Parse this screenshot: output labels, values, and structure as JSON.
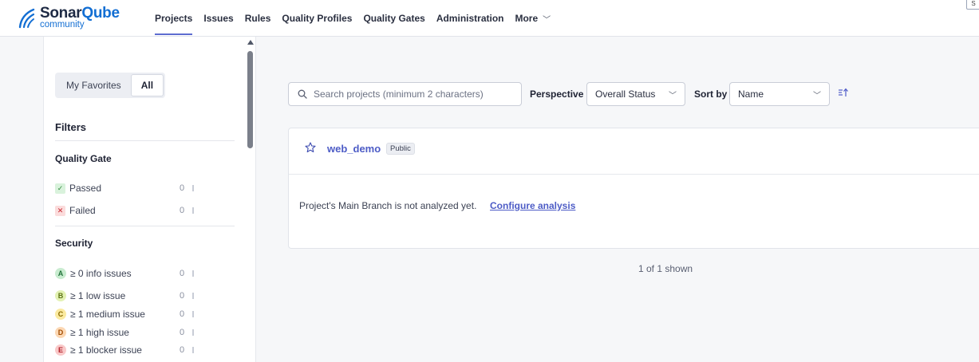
{
  "brand": {
    "name_part1": "Sonar",
    "name_part2": "Qube",
    "edition": "community",
    "accent_color": "#126ed3"
  },
  "nav": {
    "items": [
      {
        "label": "Projects",
        "active": true
      },
      {
        "label": "Issues"
      },
      {
        "label": "Rules"
      },
      {
        "label": "Quality Profiles"
      },
      {
        "label": "Quality Gates"
      },
      {
        "label": "Administration"
      },
      {
        "label": "More"
      }
    ],
    "corner_chip": "S"
  },
  "sidebar": {
    "toggle": {
      "favorites": "My Favorites",
      "all": "All",
      "selected": "All"
    },
    "filters_title": "Filters",
    "quality_gate": {
      "title": "Quality Gate",
      "items": [
        {
          "label": "Passed",
          "count": "0",
          "badge": "✓"
        },
        {
          "label": "Failed",
          "count": "0",
          "badge": "✕"
        }
      ]
    },
    "security": {
      "title": "Security",
      "items": [
        {
          "grade": "A",
          "label": "≥ 0 info issues",
          "count": "0"
        },
        {
          "grade": "B",
          "label": "≥ 1 low issue",
          "count": "0"
        },
        {
          "grade": "C",
          "label": "≥ 1 medium issue",
          "count": "0"
        },
        {
          "grade": "D",
          "label": "≥ 1 high issue",
          "count": "0"
        },
        {
          "grade": "E",
          "label": "≥ 1 blocker issue",
          "count": "0"
        }
      ]
    }
  },
  "toolbar": {
    "search_placeholder": "Search projects (minimum 2 characters)",
    "perspective_label": "Perspective",
    "perspective_value": "Overall Status",
    "sort_label": "Sort by",
    "sort_value": "Name",
    "sort_direction_icon": "sort-ascending-icon"
  },
  "project": {
    "name": "web_demo",
    "visibility": "Public",
    "message": "Project's Main Branch is not analyzed yet.",
    "link_label": "Configure analysis"
  },
  "footer": {
    "shown": "1 of 1 shown"
  }
}
